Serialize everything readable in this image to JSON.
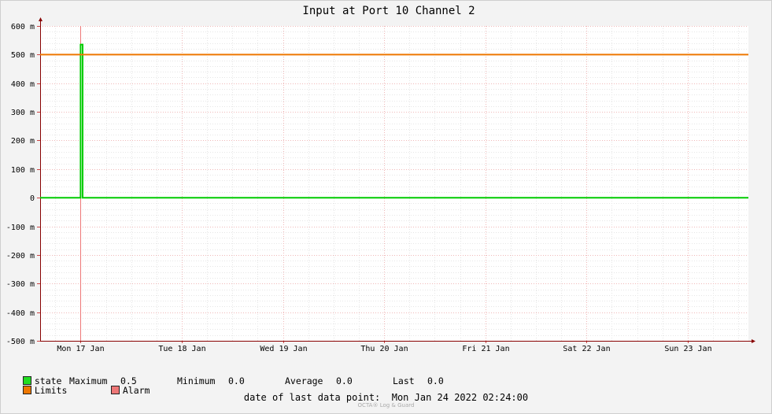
{
  "chart_data": {
    "type": "line",
    "title": "Input at Port 10 Channel 2",
    "y_tick_labels": [
      "600 m",
      "500 m",
      "400 m",
      "300 m",
      "200 m",
      "100 m",
      "0",
      "-100 m",
      "-200 m",
      "-300 m",
      "-400 m",
      "-500 m"
    ],
    "y_ticks": [
      0.6,
      0.5,
      0.4,
      0.3,
      0.2,
      0.1,
      0,
      -0.1,
      -0.2,
      -0.3,
      -0.4,
      -0.5
    ],
    "ylim": [
      -0.5,
      0.6
    ],
    "x_tick_labels": [
      "Mon 17 Jan",
      "Tue 18 Jan",
      "Wed 19 Jan",
      "Thu 20 Jan",
      "Fri 21 Jan",
      "Sat 22 Jan",
      "Sun 23 Jan"
    ],
    "xlim_days": [
      16.6,
      23.6
    ],
    "grid": true,
    "series": [
      {
        "name": "state",
        "color": "#00cc00",
        "points": [
          [
            16.6,
            0
          ],
          [
            17.0,
            0
          ],
          [
            17.0,
            0.535
          ],
          [
            17.02,
            0.535
          ],
          [
            17.02,
            0
          ],
          [
            23.6,
            0
          ]
        ]
      },
      {
        "name": "Limits",
        "color": "#ee7700",
        "points": [
          [
            16.6,
            0.5
          ],
          [
            23.6,
            0.5
          ]
        ]
      }
    ],
    "alarm_marker_day": 17.0,
    "alarm_color": "#ee7777"
  },
  "legend": {
    "state_label": "state",
    "state_color": "#22dd22",
    "stats": {
      "max_label": "Maximum",
      "max_value": "0.5",
      "min_label": "Minimum",
      "min_value": "0.0",
      "avg_label": "Average",
      "avg_value": "0.0",
      "last_label": "Last",
      "last_value": "0.0"
    },
    "limits_label": "Limits",
    "limits_color": "#ee7700",
    "alarm_label": "Alarm",
    "alarm_color": "#ee7777"
  },
  "footer": {
    "last_point_label": "date of last data point:",
    "last_point_value": "Mon Jan 24 2022 02:24:00",
    "watermark": "OCTA® Log & Guard"
  }
}
